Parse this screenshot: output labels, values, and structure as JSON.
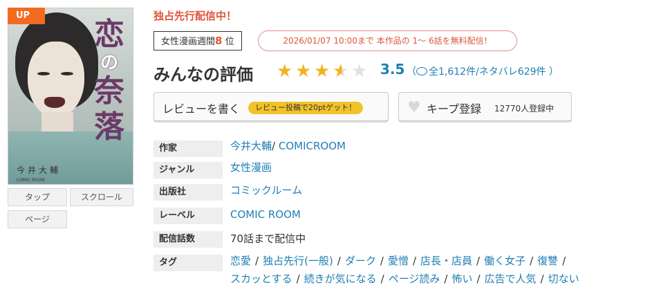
{
  "cover": {
    "badge": "UP",
    "title_chars": [
      "恋",
      "の",
      "奈",
      "落"
    ],
    "author": "今井大輔",
    "publisher_small": "COMIC ROOM"
  },
  "view_buttons": {
    "tap": "タップ",
    "scroll": "スクロール",
    "page": "ページ"
  },
  "header": {
    "exclusive": "独占先行配信中！"
  },
  "rank": {
    "prefix": "女性漫画週間",
    "number": "8",
    "suffix": " 位"
  },
  "free_notice": "2026/01/07 10:00まで 本作品の 1～ 6話を無料配信！",
  "reviews": {
    "title": "みんなの評価",
    "stars": [
      "full",
      "full",
      "full",
      "half",
      "empty"
    ],
    "score": "3.5",
    "counts": "全1,612件/ネタバレ629件 ）",
    "open_paren": "（"
  },
  "actions": {
    "write_review": "レビューを書く",
    "review_bonus": "レビュー投稿で20ptゲット！",
    "keep": "キープ登録",
    "keep_count": "12770人登録中"
  },
  "info": {
    "author_label": "作家",
    "author": "今井大輔",
    "author_sep": "/",
    "studio": "COMICROOM",
    "genre_label": "ジャンル",
    "genre": "女性漫画",
    "publisher_label": "出版社",
    "publisher": "コミックルーム",
    "label_label": "レーベル",
    "label": "COMIC ROOM",
    "episodes_label": "配信話数",
    "episodes": "70話まで配信中",
    "tags_label": "タグ",
    "tags": [
      "恋愛",
      "独占先行(一般)",
      "ダーク",
      "愛憎",
      "店長・店員",
      "働く女子",
      "復讐",
      "スカッとする",
      "続きが気になる",
      "ページ読み",
      "怖い",
      "広告で人気",
      "切ない"
    ]
  },
  "colors": {
    "accent": "#e0553a",
    "link": "#1e7fb4",
    "star": "#f1b41f",
    "badge": "#f36b21",
    "pill": "#f2c229"
  }
}
